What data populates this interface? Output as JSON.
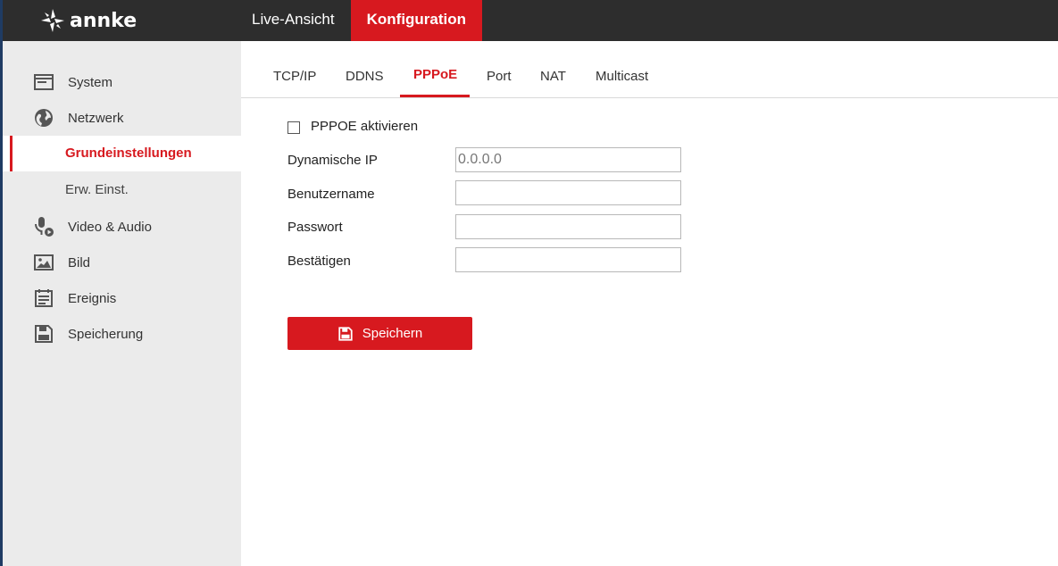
{
  "app": {
    "logo_text": "annke"
  },
  "topnav": {
    "items": [
      {
        "label": "Live-Ansicht",
        "active": false
      },
      {
        "label": "Konfiguration",
        "active": true
      }
    ]
  },
  "sidebar": {
    "items": [
      {
        "label": "System",
        "icon": "system-icon"
      },
      {
        "label": "Netzwerk",
        "icon": "globe-icon"
      },
      {
        "label": "Video & Audio",
        "icon": "video-audio-icon"
      },
      {
        "label": "Bild",
        "icon": "image-icon"
      },
      {
        "label": "Ereignis",
        "icon": "calendar-icon"
      },
      {
        "label": "Speicherung",
        "icon": "storage-icon"
      }
    ],
    "subitems": [
      {
        "label": "Grundeinstellungen",
        "active": true
      },
      {
        "label": "Erw. Einst.",
        "active": false
      }
    ]
  },
  "tabs": [
    {
      "label": "TCP/IP",
      "active": false
    },
    {
      "label": "DDNS",
      "active": false
    },
    {
      "label": "PPPoE",
      "active": true
    },
    {
      "label": "Port",
      "active": false
    },
    {
      "label": "NAT",
      "active": false
    },
    {
      "label": "Multicast",
      "active": false
    }
  ],
  "form": {
    "enable_label": "PPPOE aktivieren",
    "enable_checked": false,
    "fields": [
      {
        "label": "Dynamische IP",
        "value": "0.0.0.0"
      },
      {
        "label": "Benutzername",
        "value": ""
      },
      {
        "label": "Passwort",
        "value": ""
      },
      {
        "label": "Bestätigen",
        "value": ""
      }
    ],
    "save_label": "Speichern"
  },
  "colors": {
    "accent": "#d7191f",
    "topbar": "#2d2d2d",
    "sidebar": "#ebebeb"
  }
}
